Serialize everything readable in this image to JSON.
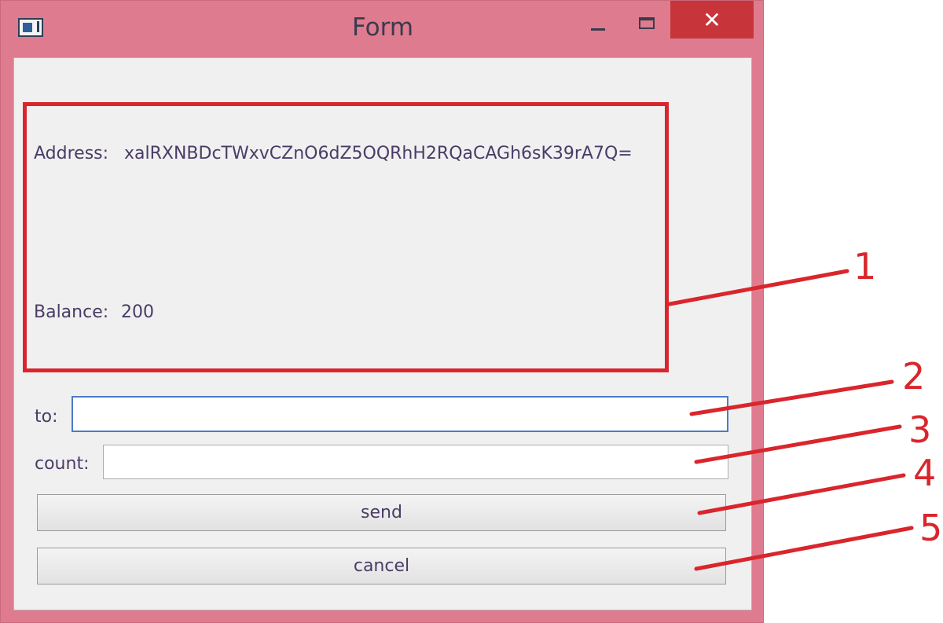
{
  "window": {
    "title": "Form",
    "close_glyph": "✕",
    "icons": {
      "app": "form-app-icon",
      "minimize": "minimize-icon",
      "maximize": "maximize-icon",
      "close": "close-icon"
    },
    "accent_color": "#df7b8e",
    "close_color": "#c7353a"
  },
  "info_box": {
    "address_label": "Address:",
    "address_value": "xalRXNBDcTWxvCZnO6dZ5OQRhH2RQaCAGh6sK39rA7Q=",
    "balance_label": "Balance:",
    "balance_value": "200"
  },
  "form": {
    "to_label": "to:",
    "to_value": "",
    "count_label": "count:",
    "count_value": "",
    "send_label": "send",
    "cancel_label": "cancel"
  },
  "annotations": {
    "color": "#d9262c",
    "callouts": [
      "1",
      "2",
      "3",
      "4",
      "5"
    ]
  }
}
